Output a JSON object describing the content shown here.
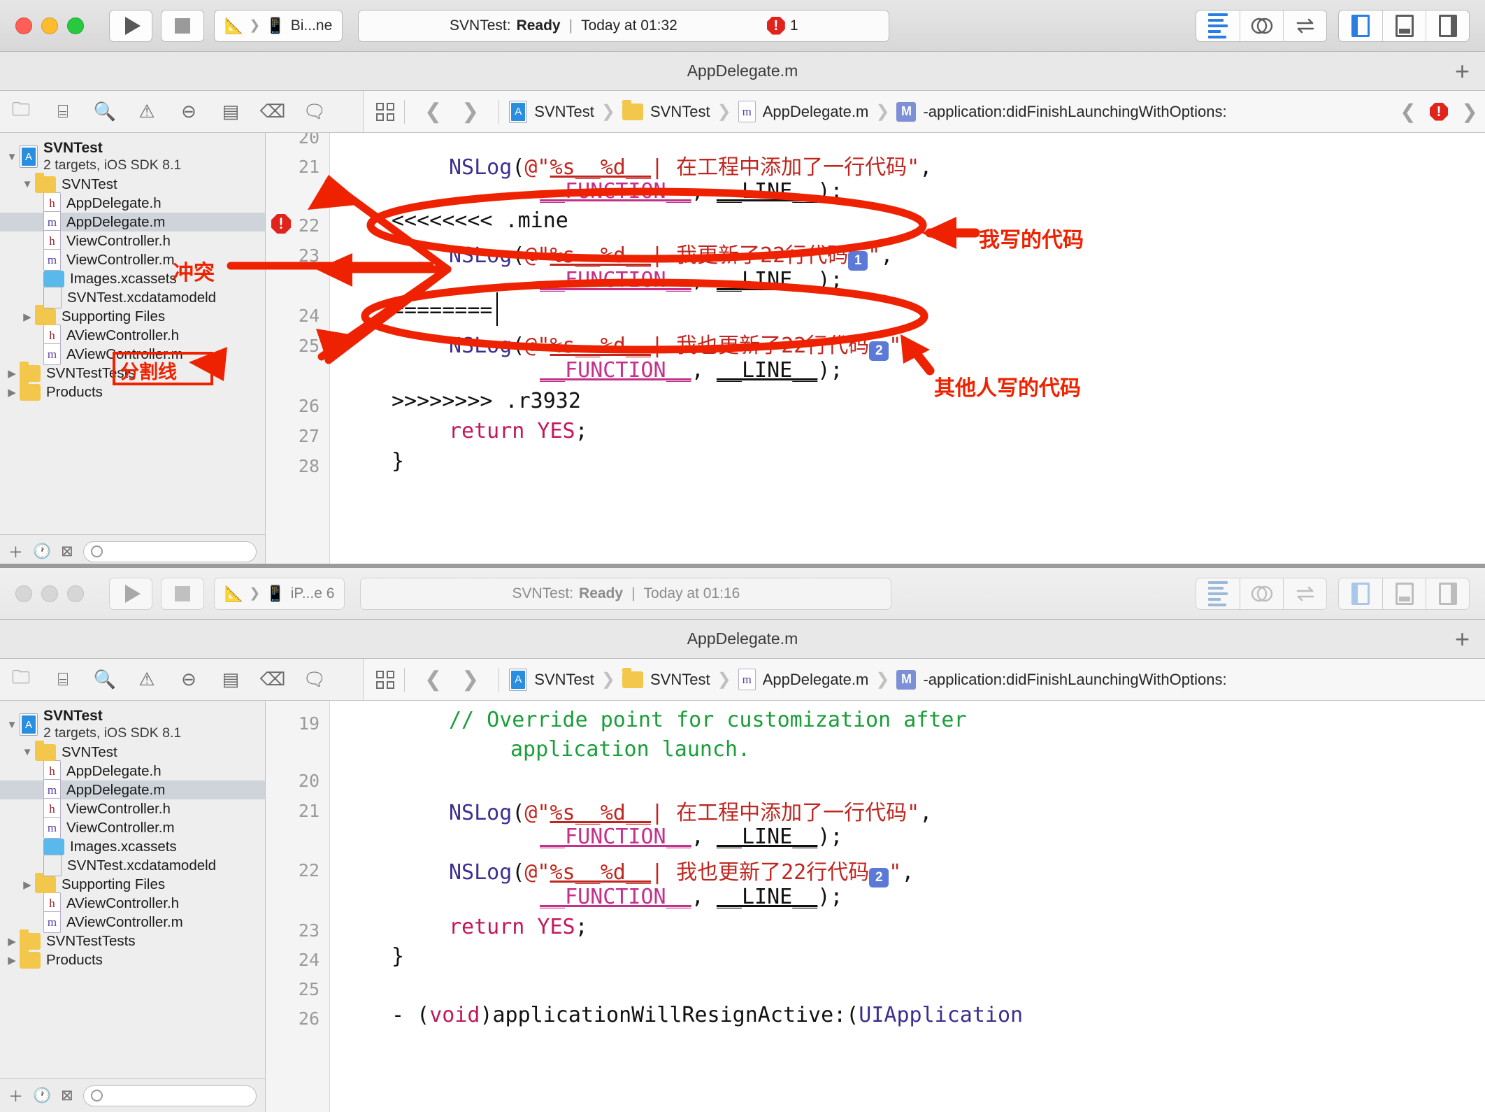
{
  "windows": [
    {
      "id": "top",
      "toolbar": {
        "scheme_target": "Bi...ne",
        "status_project": "SVNTest:",
        "status_state": "Ready",
        "status_sep": "|",
        "status_time": "Today at 01:32",
        "error_count": "1",
        "error_icon": "error-octagon-icon"
      },
      "title": "AppDelegate.m",
      "add_tab_label": "+",
      "breadcrumb": [
        {
          "icon": "project-icon",
          "label": "SVNTest"
        },
        {
          "icon": "folder-icon",
          "label": "SVNTest"
        },
        {
          "icon": "m-file-icon",
          "label": "AppDelegate.m"
        },
        {
          "icon": "method-badge-icon",
          "label": "-application:didFinishLaunchingWithOptions:"
        }
      ],
      "navigator": {
        "root": {
          "name": "SVNTest",
          "subtitle": "2 targets, iOS SDK 8.1"
        },
        "items": [
          {
            "label": "SVNTest",
            "icon": "folder-icon",
            "indent": 1,
            "disclosure": "open",
            "selected": false
          },
          {
            "label": "AppDelegate.h",
            "icon": "h-file-icon",
            "indent": 2,
            "disclosure": "",
            "selected": false
          },
          {
            "label": "AppDelegate.m",
            "icon": "m-file-icon",
            "indent": 2,
            "disclosure": "",
            "selected": true
          },
          {
            "label": "ViewController.h",
            "icon": "h-file-icon",
            "indent": 2,
            "disclosure": "",
            "selected": false
          },
          {
            "label": "ViewController.m",
            "icon": "m-file-icon",
            "indent": 2,
            "disclosure": "",
            "selected": false
          },
          {
            "label": "Images.xcassets",
            "icon": "xcassets-icon",
            "indent": 2,
            "disclosure": "",
            "selected": false
          },
          {
            "label": "SVNTest.xcdatamodeld",
            "icon": "datamodel-icon",
            "indent": 2,
            "disclosure": "",
            "selected": false
          },
          {
            "label": "Supporting Files",
            "icon": "folder-icon",
            "indent": 1,
            "disclosure": "closed",
            "selected": false
          },
          {
            "label": "AViewController.h",
            "icon": "h-file-icon",
            "indent": 2,
            "disclosure": "",
            "selected": false
          },
          {
            "label": "AViewController.m",
            "icon": "m-file-icon",
            "indent": 2,
            "disclosure": "",
            "selected": false
          },
          {
            "label": "SVNTestTests",
            "icon": "folder-icon",
            "indent": 0,
            "disclosure": "closed",
            "selected": false
          },
          {
            "label": "Products",
            "icon": "folder-icon",
            "indent": 0,
            "disclosure": "closed",
            "selected": false
          }
        ]
      },
      "code": {
        "first_visible_line": "20",
        "lines": [
          {
            "num": "20",
            "text": "",
            "error": false
          },
          {
            "num": "21",
            "text": "NSLog(@\"%s__%d__| 在工程中添加了一行代码\",",
            "error": false
          },
          {
            "num": "",
            "text": "__FUNCTION__, __LINE__);",
            "error": false
          },
          {
            "num": "22",
            "text": "<<<<<<<< .mine",
            "error": true
          },
          {
            "num": "23",
            "text": "NSLog(@\"%s__%d__| 我更新了22行代码1\",",
            "error": false
          },
          {
            "num": "",
            "text": "__FUNCTION__, __LINE__);",
            "error": false
          },
          {
            "num": "24",
            "text": "========",
            "error": false
          },
          {
            "num": "25",
            "text": "NSLog(@\"%s__%d__| 我也更新了22行代码2\",",
            "error": false
          },
          {
            "num": "",
            "text": "__FUNCTION__, __LINE__);",
            "error": false
          },
          {
            "num": "26",
            "text": ">>>>>>>> .r3932",
            "error": false
          },
          {
            "num": "27",
            "text": "return YES;",
            "error": false
          },
          {
            "num": "28",
            "text": "}",
            "error": false
          }
        ]
      },
      "annotations": [
        {
          "name": "conflict-label",
          "text": "冲突"
        },
        {
          "name": "separator-label",
          "text": "分割线"
        },
        {
          "name": "my-code-label",
          "text": "我写的代码"
        },
        {
          "name": "others-code-label",
          "text": "其他人写的代码"
        }
      ]
    },
    {
      "id": "bottom",
      "toolbar": {
        "scheme_target": "iP...e 6",
        "status_project": "SVNTest:",
        "status_state": "Ready",
        "status_sep": "|",
        "status_time": "Today at 01:16",
        "error_count": "",
        "error_icon": ""
      },
      "title": "AppDelegate.m",
      "add_tab_label": "+",
      "breadcrumb": [
        {
          "icon": "project-icon",
          "label": "SVNTest"
        },
        {
          "icon": "folder-icon",
          "label": "SVNTest"
        },
        {
          "icon": "m-file-icon",
          "label": "AppDelegate.m"
        },
        {
          "icon": "method-badge-icon",
          "label": "-application:didFinishLaunchingWithOptions:"
        }
      ],
      "navigator": {
        "root": {
          "name": "SVNTest",
          "subtitle": "2 targets, iOS SDK 8.1"
        },
        "items": [
          {
            "label": "SVNTest",
            "icon": "folder-icon",
            "indent": 1,
            "disclosure": "open",
            "selected": false
          },
          {
            "label": "AppDelegate.h",
            "icon": "h-file-icon",
            "indent": 2,
            "disclosure": "",
            "selected": false
          },
          {
            "label": "AppDelegate.m",
            "icon": "m-file-icon",
            "indent": 2,
            "disclosure": "",
            "selected": true
          },
          {
            "label": "ViewController.h",
            "icon": "h-file-icon",
            "indent": 2,
            "disclosure": "",
            "selected": false
          },
          {
            "label": "ViewController.m",
            "icon": "m-file-icon",
            "indent": 2,
            "disclosure": "",
            "selected": false
          },
          {
            "label": "Images.xcassets",
            "icon": "xcassets-icon",
            "indent": 2,
            "disclosure": "",
            "selected": false
          },
          {
            "label": "SVNTest.xcdatamodeld",
            "icon": "datamodel-icon",
            "indent": 2,
            "disclosure": "",
            "selected": false
          },
          {
            "label": "Supporting Files",
            "icon": "folder-icon",
            "indent": 1,
            "disclosure": "closed",
            "selected": false
          },
          {
            "label": "AViewController.h",
            "icon": "h-file-icon",
            "indent": 2,
            "disclosure": "",
            "selected": false
          },
          {
            "label": "AViewController.m",
            "icon": "m-file-icon",
            "indent": 2,
            "disclosure": "",
            "selected": false
          },
          {
            "label": "SVNTestTests",
            "icon": "folder-icon",
            "indent": 0,
            "disclosure": "closed",
            "selected": false
          },
          {
            "label": "Products",
            "icon": "folder-icon",
            "indent": 0,
            "disclosure": "closed",
            "selected": false
          }
        ]
      },
      "code": {
        "first_visible_line": "19",
        "lines": [
          {
            "num": "19",
            "text": "// Override point for customization after",
            "error": false
          },
          {
            "num": "",
            "text": "application launch.",
            "error": false
          },
          {
            "num": "20",
            "text": "",
            "error": false
          },
          {
            "num": "21",
            "text": "NSLog(@\"%s__%d__| 在工程中添加了一行代码\",",
            "error": false
          },
          {
            "num": "",
            "text": "__FUNCTION__, __LINE__);",
            "error": false
          },
          {
            "num": "22",
            "text": "NSLog(@\"%s__%d__| 我也更新了22行代码2\",",
            "error": false
          },
          {
            "num": "",
            "text": "__FUNCTION__, __LINE__);",
            "error": false
          },
          {
            "num": "23",
            "text": "return YES;",
            "error": false
          },
          {
            "num": "24",
            "text": "}",
            "error": false
          },
          {
            "num": "25",
            "text": "",
            "error": false
          },
          {
            "num": "26",
            "text": "- (void)applicationWillResignActive:(UIApplication",
            "error": false
          }
        ]
      },
      "annotations": []
    }
  ],
  "colors": {
    "accent_blue": "#2a7de1",
    "error_red": "#e0241b",
    "annotation_red": "#ee2200",
    "string_red": "#c0261f",
    "macro_magenta": "#c4308a",
    "function_purple": "#3d2f8f",
    "keyword_pink": "#c2185b",
    "comment_green": "#1a9e3a",
    "selection_gray": "#cfd4da"
  }
}
